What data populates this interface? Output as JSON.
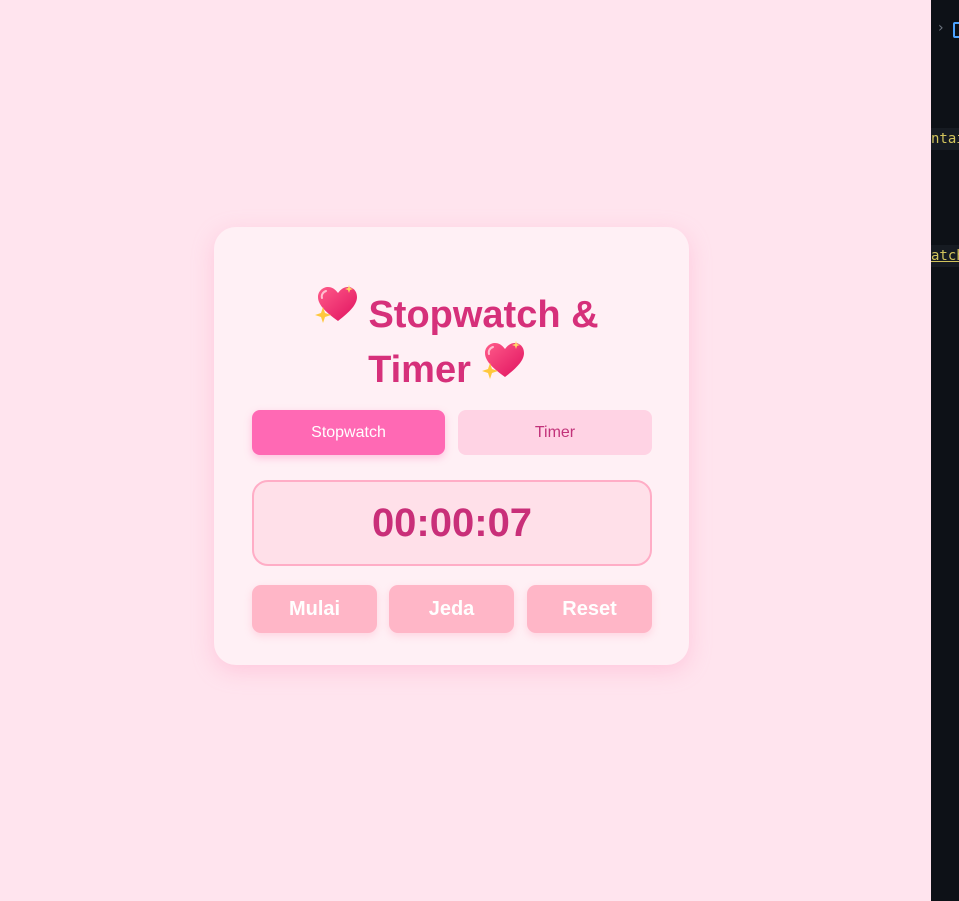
{
  "app": {
    "title_line1": "Stopwatch &",
    "title_line2": "Timer",
    "title_icon": "sparkling-heart"
  },
  "tabs": [
    {
      "label": "Stopwatch",
      "active": true
    },
    {
      "label": "Timer",
      "active": false
    }
  ],
  "display": {
    "time": "00:00:07"
  },
  "controls": {
    "start_label": "Mulai",
    "pause_label": "Jeda",
    "reset_label": "Reset"
  },
  "editor_strip": {
    "snippet_1": "ntai",
    "snippet_2": "atch"
  },
  "colors": {
    "page_bg": "#ffe4ee",
    "card_bg": "#fff0f5",
    "accent": "#ff69b4",
    "title": "#d6307a",
    "button": "#ffb6c7",
    "editor_bg": "#0d1117"
  }
}
